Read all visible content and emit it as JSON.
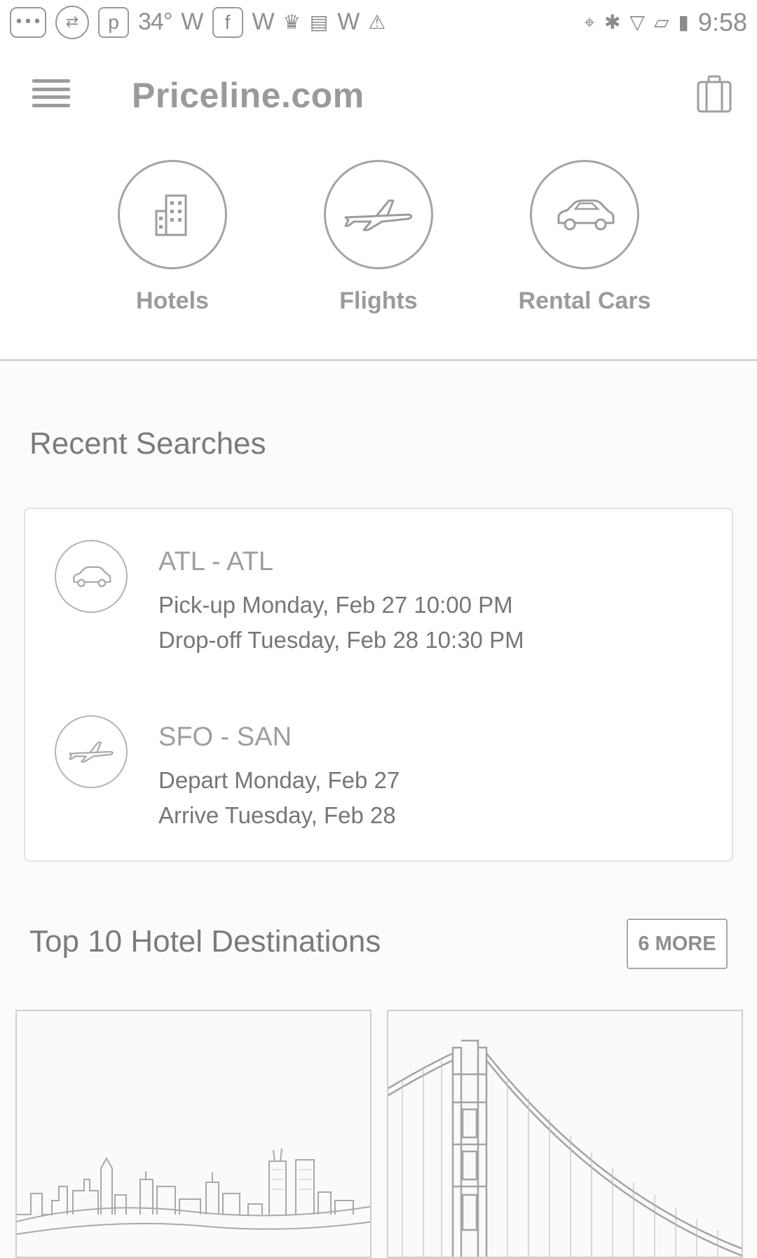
{
  "status_bar": {
    "temperature": "34°",
    "time": "9:58",
    "icons": [
      "more-icon",
      "usb-icon",
      "parking-icon",
      "weather-icon",
      "facebook-icon",
      "weather-icon",
      "crown-icon",
      "news-icon",
      "weather-icon",
      "warning-icon",
      "location-icon",
      "bluetooth-icon",
      "wifi-icon",
      "no-sim-icon",
      "battery-charging-icon"
    ]
  },
  "app_bar": {
    "title": "Priceline.com"
  },
  "products": [
    {
      "label": "Hotels",
      "icon": "hotel-icon"
    },
    {
      "label": "Flights",
      "icon": "airplane-icon"
    },
    {
      "label": "Rental Cars",
      "icon": "car-icon"
    }
  ],
  "recent_searches": {
    "title": "Recent Searches",
    "items": [
      {
        "icon": "car-icon",
        "title": "ATL - ATL",
        "line1": "Pick-up Monday, Feb 27 10:00 PM",
        "line2": "Drop-off Tuesday, Feb 28 10:30 PM"
      },
      {
        "icon": "airplane-icon",
        "title": "SFO - SAN",
        "line1": "Depart Monday, Feb 27",
        "line2": "Arrive Tuesday, Feb 28"
      }
    ]
  },
  "top_destinations": {
    "title": "Top 10 Hotel Destinations",
    "more_label": "6 MORE",
    "cards": [
      {
        "image": "city-skyline-image"
      },
      {
        "image": "golden-gate-bridge-image"
      }
    ]
  }
}
